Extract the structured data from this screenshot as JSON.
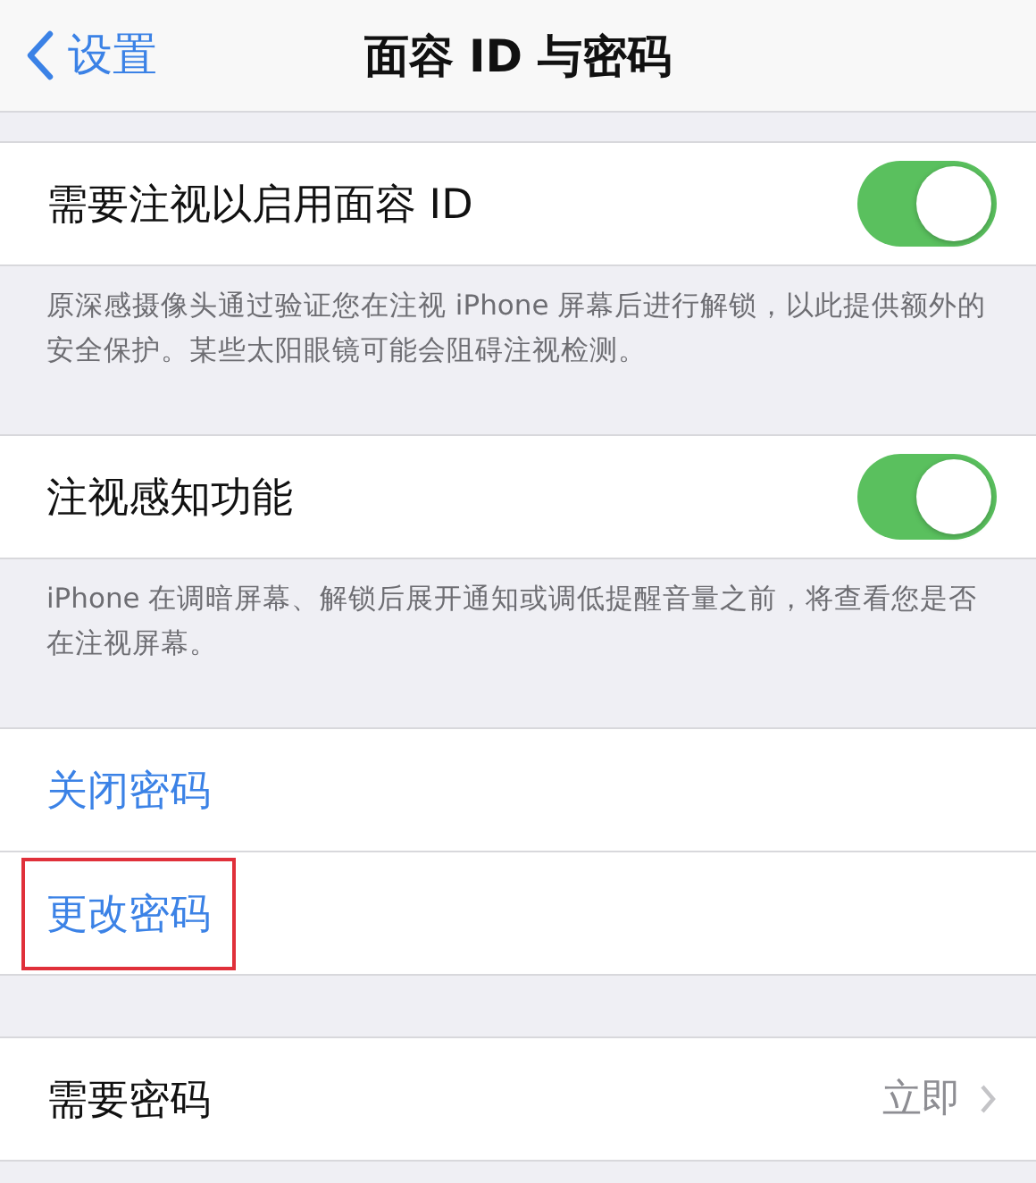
{
  "nav": {
    "back": "设置",
    "title": "面容 ID 与密码"
  },
  "sections": [
    {
      "rows": [
        {
          "kind": "toggle",
          "label": "需要注视以启用面容 ID",
          "on": true
        }
      ],
      "footer": "原深感摄像头通过验证您在注视 iPhone 屏幕后进行解锁，以此提供额外的安全保护。某些太阳眼镜可能会阻碍注视检测。"
    },
    {
      "rows": [
        {
          "kind": "toggle",
          "label": "注视感知功能",
          "on": true
        }
      ],
      "footer": "iPhone 在调暗屏幕、解锁后展开通知或调低提醒音量之前，将查看您是否在注视屏幕。"
    },
    {
      "rows": [
        {
          "kind": "link",
          "label": "关闭密码",
          "highlighted": false
        },
        {
          "kind": "link",
          "label": "更改密码",
          "highlighted": true
        }
      ]
    },
    {
      "rows": [
        {
          "kind": "value",
          "label": "需要密码",
          "value": "立即"
        }
      ]
    }
  ]
}
